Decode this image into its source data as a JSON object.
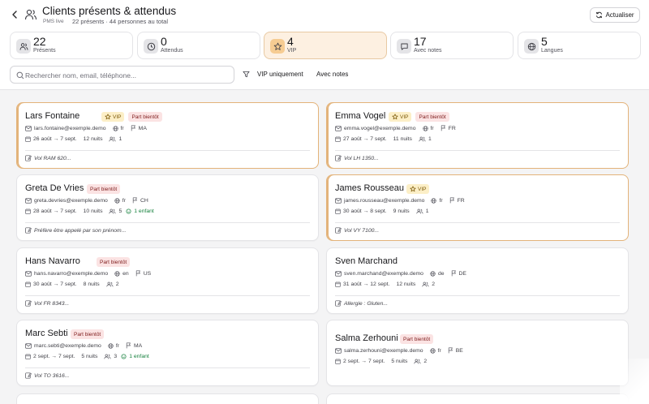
{
  "header": {
    "title": "Clients présents & attendus",
    "subtitle": "PMS live",
    "summary": "22 présents · 44 personnes au total",
    "refresh_label": "Actualiser"
  },
  "stats": [
    {
      "value": "22",
      "label": "Présents",
      "icon": "users-icon",
      "active": false
    },
    {
      "value": "0",
      "label": "Attendus",
      "icon": "clock-icon",
      "active": false
    },
    {
      "value": "4",
      "label": "VIP",
      "icon": "star-icon",
      "active": true
    },
    {
      "value": "17",
      "label": "Avec notes",
      "icon": "message-icon",
      "active": false
    },
    {
      "value": "5",
      "label": "Langues",
      "icon": "globe-icon",
      "active": false
    }
  ],
  "search": {
    "placeholder": "Rechercher nom, email, téléphone...",
    "value": ""
  },
  "filters": {
    "vip_only": "VIP uniquement",
    "with_notes": "Avec notes"
  },
  "labels": {
    "vip": "VIP",
    "leaving_soon": "Part bientôt"
  },
  "colors": {
    "accent": "#e3b37a",
    "vip_badge_bg": "#fcefc7",
    "leave_badge_bg": "#fbe3e3",
    "active_stat_bg": "#fdf0e1"
  },
  "guests": [
    {
      "name": "Lars Fontaine",
      "vip": true,
      "leaving_soon": true,
      "email": "lars.fontaine@exemple.demo",
      "lang": "fr",
      "country": "MA",
      "dates": "26 août → 7 sept.",
      "nights": "12 nuits",
      "persons": "1",
      "children": "",
      "note": "Vol RAM 620..."
    },
    {
      "name": "Emma Vogel",
      "vip": true,
      "leaving_soon": true,
      "email": "emma.vogel@exemple.demo",
      "lang": "fr",
      "country": "FR",
      "dates": "27 août → 7 sept.",
      "nights": "11 nuits",
      "persons": "1",
      "children": "",
      "note": "Vol LH 1350..."
    },
    {
      "name": "Greta De Vries",
      "vip": false,
      "leaving_soon": true,
      "email": "greta.devries@exemple.demo",
      "lang": "fr",
      "country": "CH",
      "dates": "28 août → 7 sept.",
      "nights": "10 nuits",
      "persons": "5",
      "children": "1 enfant",
      "note": "Préfère être appelé par son prénom..."
    },
    {
      "name": "James Rousseau",
      "vip": true,
      "leaving_soon": false,
      "email": "james.rousseau@exemple.demo",
      "lang": "fr",
      "country": "FR",
      "dates": "30 août → 8 sept.",
      "nights": "9 nuits",
      "persons": "1",
      "children": "",
      "note": "Vol VY 7100..."
    },
    {
      "name": "Hans Navarro",
      "vip": false,
      "leaving_soon": true,
      "email": "hans.navarro@exemple.demo",
      "lang": "en",
      "country": "US",
      "dates": "30 août → 7 sept.",
      "nights": "8 nuits",
      "persons": "2",
      "children": "",
      "note": "Vol FR 8343..."
    },
    {
      "name": "Sven Marchand",
      "vip": false,
      "leaving_soon": false,
      "email": "sven.marchand@exemple.demo",
      "lang": "de",
      "country": "DE",
      "dates": "31 août → 12 sept.",
      "nights": "12 nuits",
      "persons": "2",
      "children": "",
      "note": "Allergie : Gluten..."
    },
    {
      "name": "Marc Sebti",
      "vip": false,
      "leaving_soon": true,
      "email": "marc.sebti@exemple.demo",
      "lang": "fr",
      "country": "MA",
      "dates": "2 sept. → 7 sept.",
      "nights": "5 nuits",
      "persons": "3",
      "children": "1 enfant",
      "note": "Vol TO 3616..."
    },
    {
      "name": "Salma Zerhouni",
      "vip": false,
      "leaving_soon": true,
      "email": "salma.zerhouni@exemple.demo",
      "lang": "fr",
      "country": "BE",
      "dates": "2 sept. → 7 sept.",
      "nights": "5 nuits",
      "persons": "2",
      "children": "",
      "note": ""
    }
  ]
}
